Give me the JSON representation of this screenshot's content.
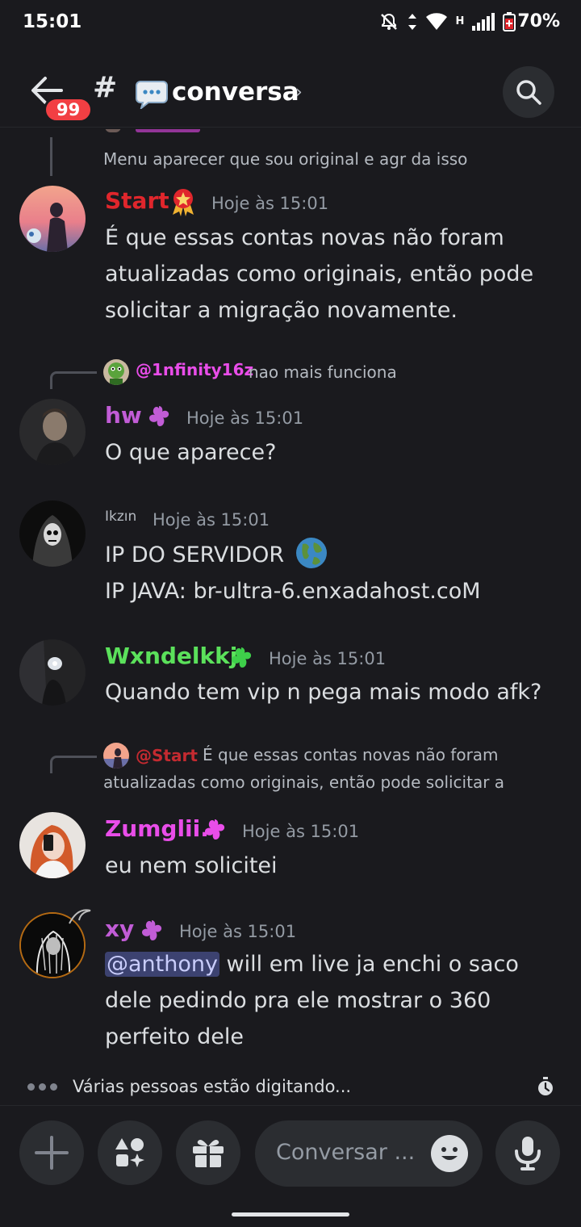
{
  "status_bar": {
    "time": "15:01",
    "network_label": "H",
    "battery": "70%"
  },
  "header": {
    "badge_count": "99",
    "channel_name": "conversa"
  },
  "messages": {
    "m0": {
      "reply_preview": "Menu aparecer que sou original e agr da isso"
    },
    "m1": {
      "username": "Start",
      "username_color": "#e0262c",
      "timestamp": "Hoje às 15:01",
      "content": "É que essas contas novas não foram atualizadas como originais, então pode solicitar a migração novamente."
    },
    "m2": {
      "reply_user": "@1nfinity16z",
      "reply_text": "nao mais funciona",
      "username": "hw",
      "username_color": "#c15cd6",
      "timestamp": "Hoje às 15:01",
      "content": "O que aparece?"
    },
    "m3": {
      "username": "Ikzın",
      "timestamp": "Hoje às 15:01",
      "line1": "IP DO SERVIDOR",
      "line2": "IP JAVA: br-ultra-6.enxadahost.coM"
    },
    "m4": {
      "username": "Wxndelkkj",
      "username_color": "#5be15b",
      "timestamp": "Hoje às 15:01",
      "content": "Quando tem vip n pega mais modo afk?"
    },
    "m5": {
      "reply_user": "@Start",
      "reply_line1": "É que essas contas novas não foram",
      "reply_line2": "atualizadas como originais, então pode solicitar a",
      "username": "Zumglii.",
      "username_color": "#e94de9",
      "timestamp": "Hoje às 15:01",
      "content": "eu nem solicitei"
    },
    "m6": {
      "username": "xy",
      "username_color": "#c15cd6",
      "timestamp": "Hoje às 15:01",
      "mention": "@anthony",
      "content_line1": " will em live ja enchi o saco",
      "content_rest": "dele pedindo pra ele mostrar o 360 perfeito dele"
    }
  },
  "typing_indicator": "Várias pessoas estão digitando...",
  "composer": {
    "placeholder": "Conversar ..."
  }
}
